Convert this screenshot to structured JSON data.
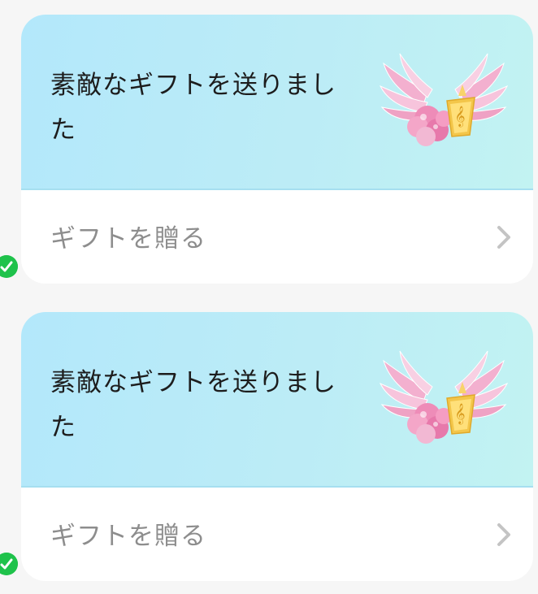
{
  "messages": [
    {
      "text": "素敵なギフトを送りました",
      "gift_image": "winged-flower-and-music-box-gift",
      "action_label": "ギフトを贈る",
      "action_icon": "chevron-right-icon",
      "status_icon": "sent-check-icon"
    },
    {
      "text": "素敵なギフトを送りました",
      "gift_image": "winged-flower-and-music-box-gift",
      "action_label": "ギフトを贈る",
      "action_icon": "chevron-right-icon",
      "status_icon": "sent-check-icon"
    }
  ],
  "colors": {
    "bubble_gradient_start": "#b3e8fb",
    "bubble_gradient_end": "#c2f3f2",
    "check_green": "#1fc24b",
    "label_gray": "#8d8d8d"
  }
}
